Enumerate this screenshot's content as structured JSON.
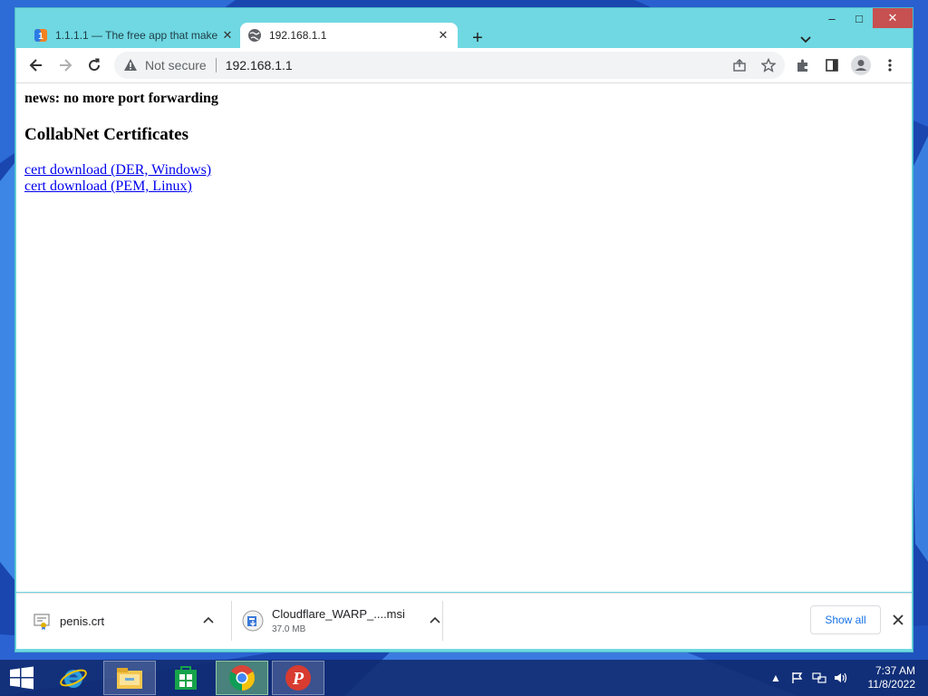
{
  "browser": {
    "tabs": [
      {
        "title": "1.1.1.1 — The free app that make",
        "favicon": "cloudflare-1111-icon",
        "active": false
      },
      {
        "title": "192.168.1.1",
        "favicon": "globe-icon",
        "active": true
      }
    ],
    "omnibox": {
      "security_text": "Not secure",
      "url": "192.168.1.1"
    }
  },
  "page": {
    "news": "news: no more port forwarding",
    "heading": "CollabNet Certificates",
    "links": [
      "cert download (DER, Windows)",
      "cert download (PEM, Linux)"
    ]
  },
  "downloads": {
    "items": [
      {
        "name": "penis.crt",
        "size": "",
        "icon": "certificate-file-icon"
      },
      {
        "name": "Cloudflare_WARP_....msi",
        "size": "37.0 MB",
        "icon": "msi-installer-icon"
      }
    ],
    "show_all_label": "Show all"
  },
  "taskbar": {
    "apps": [
      "start-button",
      "internet-explorer-icon",
      "file-explorer-icon",
      "store-icon",
      "chrome-icon",
      "psiphon-icon"
    ],
    "clock": {
      "time": "7:37 AM",
      "date": "11/8/2022"
    }
  },
  "colors": {
    "window_frame": "#6fd8e2",
    "link": "#0000ee",
    "close_button": "#c75050",
    "accent_blue": "#1a73e8"
  }
}
